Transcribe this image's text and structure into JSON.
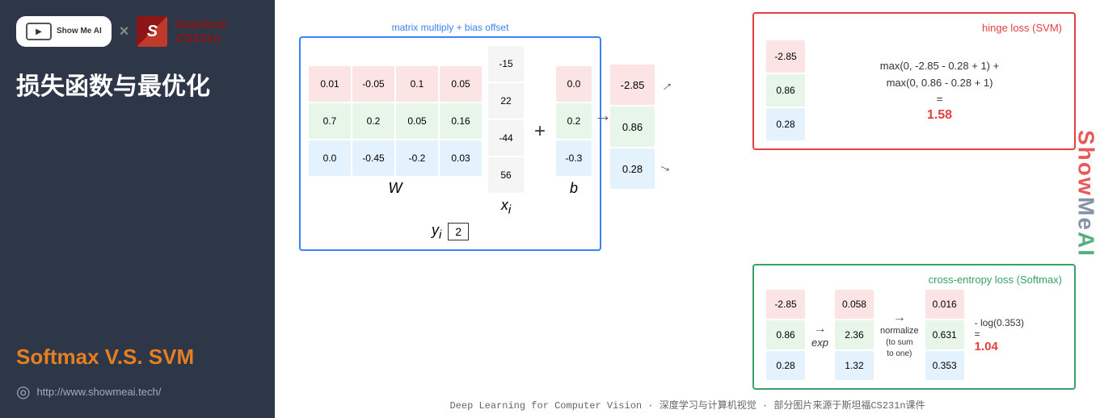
{
  "sidebar": {
    "logo_text": "Show Me AI",
    "x_symbol": "×",
    "stanford_s": "S",
    "stanford_name": "Stanford",
    "course_name": "CS231n",
    "main_title": "损失函数与最优化",
    "subtitle": "Softmax V.S. SVM",
    "website_url": "http://www.showmeai.tech/"
  },
  "content": {
    "blue_box_label": "matrix multiply + bias offset",
    "matrix_label": "W",
    "bias_label": "b",
    "xi_label": "x_i",
    "yi_label": "y_i",
    "yi_value": "2",
    "matrix_data": [
      [
        "0.01",
        "-0.05",
        "0.1",
        "0.05"
      ],
      [
        "0.7",
        "0.2",
        "0.05",
        "0.16"
      ],
      [
        "0.0",
        "-0.45",
        "-0.2",
        "0.03"
      ]
    ],
    "xi_data": [
      "-15",
      "22",
      "-44",
      "56"
    ],
    "b_data": [
      "0.0",
      "0.2",
      "-0.3"
    ],
    "scores": [
      "-2.85",
      "0.86",
      "0.28"
    ],
    "hinge_loss": {
      "title": "hinge loss (SVM)",
      "formula_line1": "max(0, -2.85 - 0.28 + 1) +",
      "formula_line2": "max(0, 0.86 - 0.28 + 1)",
      "equals": "=",
      "result": "1.58"
    },
    "cross_entropy": {
      "title": "cross-entropy loss (Softmax)",
      "exp_label": "exp",
      "normalize_label": "normalize",
      "normalize_sub": "(to sum\nto one)",
      "result_label": "- log(0.353)",
      "result_eq": "=",
      "result_value": "1.04",
      "exp_data": [
        "0.058",
        "2.36",
        "1.32"
      ],
      "norm_data": [
        "0.016",
        "0.631",
        "0.353"
      ]
    },
    "footer": "Deep Learning for Computer Vision · 深度学习与计算机视觉 · 部分图片来源于斯坦福CS231n课件",
    "watermark": "ShowMeAI"
  }
}
